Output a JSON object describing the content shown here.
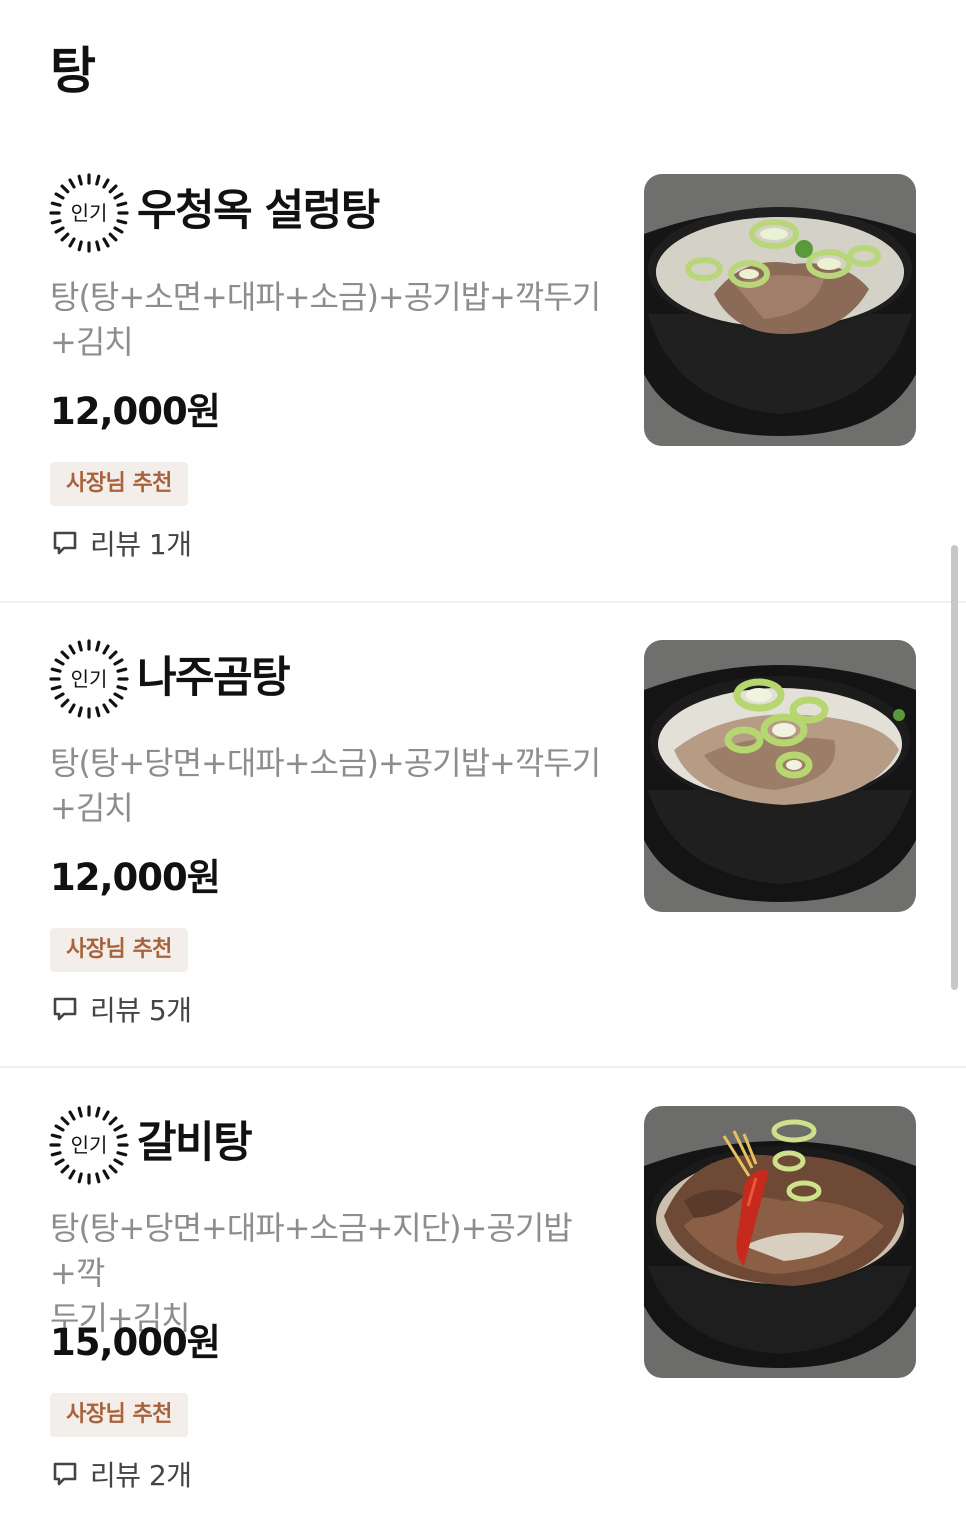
{
  "section": {
    "title": "탕"
  },
  "items": [
    {
      "badge": "인기",
      "name": "우청옥 설렁탕",
      "desc_line1": "탕(탕+소면+대파+소금)+공기밥+깍두기",
      "desc_line2": "+김치",
      "price": "12,000원",
      "tag": "사장님 추천",
      "reviews": "리뷰 1개",
      "image": "seolleongtang-photo"
    },
    {
      "badge": "인기",
      "name": "나주곰탕",
      "desc_line1": "탕(탕+당면+대파+소금)+공기밥+깍두기",
      "desc_line2": "+김치",
      "price": "12,000원",
      "tag": "사장님 추천",
      "reviews": "리뷰 5개",
      "image": "najugomtang-photo"
    },
    {
      "badge": "인기",
      "name": "갈비탕",
      "desc_line1": "탕(탕+당면+대파+소금+지단)+공기밥+깍",
      "desc_line2": "두기+김치",
      "price": "15,000원",
      "tag": "사장님 추천",
      "reviews": "리뷰 2개",
      "image": "galbitang-photo"
    }
  ],
  "colors": {
    "tag_bg": "#f4eeea",
    "tag_text": "#a8623c",
    "desc_text": "#8d8d8d",
    "divider": "#f0f0f0"
  }
}
